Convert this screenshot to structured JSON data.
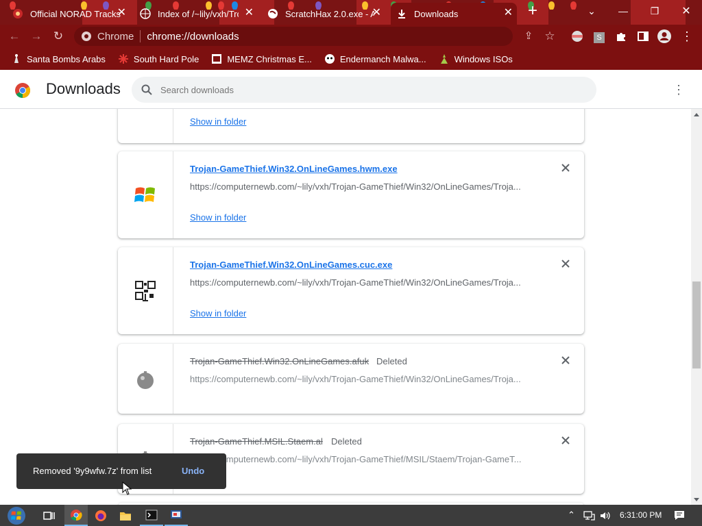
{
  "browser": {
    "tabs": [
      {
        "label": "Official NORAD Tracks",
        "active": false
      },
      {
        "label": "Index of /~lily/vxh/Tro",
        "active": false
      },
      {
        "label": "ScratchHax 2.0.exe - A",
        "active": false
      },
      {
        "label": "Downloads",
        "active": true
      }
    ],
    "omnibox": {
      "scheme_label": "Chrome",
      "url": "chrome://downloads"
    },
    "bookmarks": [
      "Santa Bombs Arabs",
      "South Hard Pole",
      "MEMZ Christmas E...",
      "Endermanch Malwa...",
      "Windows ISOs"
    ],
    "profile_badge": "S"
  },
  "downloads_page": {
    "title": "Downloads",
    "search_placeholder": "Search downloads",
    "show_in_folder": "Show in folder",
    "items": [
      {
        "name": "Trojan-GameThief.Win32.OnLineGames.hwm.exe",
        "url": "https://computernewb.com/~lily/vxh/Trojan-GameThief/Win32/OnLineGames/Troja...",
        "status": "",
        "icon": "windows-exe-icon"
      },
      {
        "name": "Trojan-GameThief.Win32.OnLineGames.cuc.exe",
        "url": "https://computernewb.com/~lily/vxh/Trojan-GameThief/Win32/OnLineGames/Troja...",
        "status": "",
        "icon": "qr-exe-icon"
      },
      {
        "name": "Trojan-GameThief.Win32.OnLineGames.afuk",
        "url": "https://computernewb.com/~lily/vxh/Trojan-GameThief/Win32/OnLineGames/Troja...",
        "status": "Deleted",
        "icon": "deleted-file-icon"
      },
      {
        "name": "Trojan-GameThief.MSIL.Staem.al",
        "url": "https://computernewb.com/~lily/vxh/Trojan-GameThief/MSIL/Staem/Trojan-GameT...",
        "status": "Deleted",
        "icon": "deleted-file-icon"
      }
    ]
  },
  "toast": {
    "message": "Removed '9y9wfw.7z' from list",
    "action": "Undo"
  },
  "taskbar": {
    "clock": "6:31:00 PM"
  },
  "colors": {
    "frame": "#7d1010",
    "link": "#1a73e8",
    "toast": "#323232",
    "taskbar": "#3c3c3c"
  }
}
